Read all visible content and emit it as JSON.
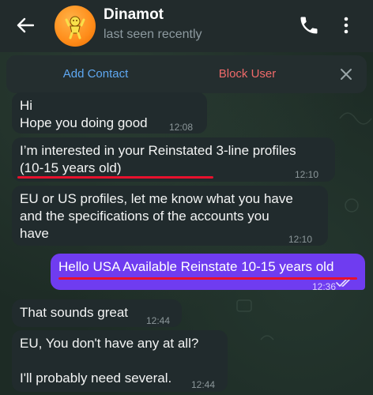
{
  "header": {
    "contact_name": "Dinamot",
    "status": "last seen recently"
  },
  "action_bar": {
    "add_contact": "Add Contact",
    "block_user": "Block User"
  },
  "messages": [
    {
      "direction": "incoming",
      "text": "Hi\nHope you doing good",
      "time": "12:08"
    },
    {
      "direction": "incoming",
      "text": "I’m interested in your Reinstated 3-line profiles\n(10-15 years old)",
      "time": "12:10"
    },
    {
      "direction": "incoming",
      "text": "EU or US profiles, let me know what you have\nand the specifications of the accounts you\nhave",
      "time": "12:10"
    },
    {
      "direction": "outgoing",
      "text": "Hello USA Available Reinstate 10-15 years old",
      "time": "12:36",
      "status": "read"
    },
    {
      "direction": "incoming",
      "text": "That sounds great",
      "time": "12:44"
    },
    {
      "direction": "incoming",
      "text": "EU, You don't have any at all?\n\nI'll probably need several.",
      "time": "12:44"
    }
  ],
  "colors": {
    "header_bg": "#222b2c",
    "incoming_bubble": "#212b2d",
    "outgoing_bubble": "#6f3cf0",
    "add_contact": "#5fa8f2",
    "block_user": "#f06a6a",
    "annotation_underline": "#e8112d"
  },
  "icons": {
    "back": "arrow-left-icon",
    "call": "phone-icon",
    "more": "more-vertical-icon",
    "close": "close-icon",
    "read": "double-check-icon"
  }
}
